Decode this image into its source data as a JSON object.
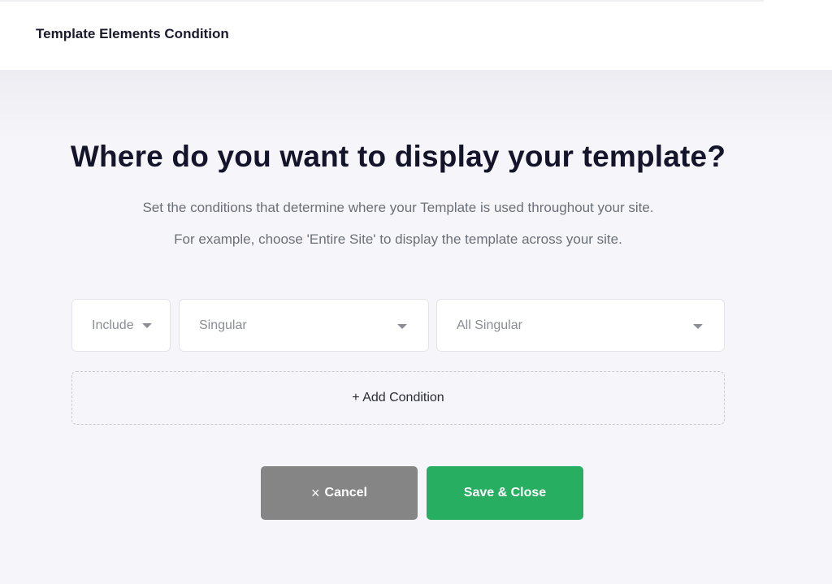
{
  "header": {
    "title": "Template Elements Condition"
  },
  "main": {
    "heading": "Where do you want to display your template?",
    "description_1": "Set the conditions that determine where your Template is used throughout your site.",
    "description_2": "For example, choose 'Entire Site' to display the template across your site."
  },
  "condition": {
    "include_select": {
      "value": "Include",
      "icon": "caret-down-icon"
    },
    "type_select": {
      "value": "Singular",
      "icon": "caret-down-icon"
    },
    "sub_select": {
      "value": "All Singular",
      "icon": "caret-down-icon"
    }
  },
  "add_condition_label": "+ Add Condition",
  "buttons": {
    "cancel_icon": "×",
    "cancel_label": "Cancel",
    "save_label": "Save & Close"
  },
  "colors": {
    "save_bg": "#27ae60",
    "cancel_bg": "#858585",
    "heading": "#14142b"
  }
}
